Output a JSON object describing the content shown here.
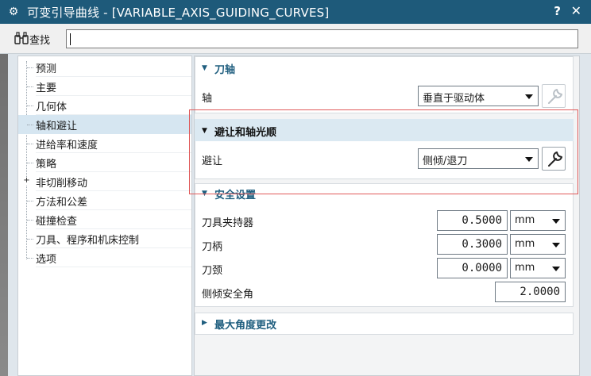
{
  "window": {
    "title": "可变引导曲线 - [VARIABLE_AXIS_GUIDING_CURVES]",
    "help_label": "?",
    "close_label": "✕",
    "title_icon": "gear-icon"
  },
  "findbar": {
    "label": "查找",
    "icon": "binoculars-icon",
    "value": ""
  },
  "tree": {
    "items": [
      {
        "label": "预测",
        "selected": false
      },
      {
        "label": "主要",
        "selected": false
      },
      {
        "label": "几何体",
        "selected": false
      },
      {
        "label": "轴和避让",
        "selected": true
      },
      {
        "label": "进给率和速度",
        "selected": false
      },
      {
        "label": "策略",
        "selected": false
      },
      {
        "label": "非切削移动",
        "selected": false,
        "expandable": true
      },
      {
        "label": "方法和公差",
        "selected": false
      },
      {
        "label": "碰撞检查",
        "selected": false
      },
      {
        "label": "刀具、程序和机床控制",
        "selected": false
      },
      {
        "label": "选项",
        "selected": false
      }
    ],
    "expand_glyph": "+"
  },
  "sections": {
    "tool_axis": {
      "title": "刀轴",
      "axis_label": "轴",
      "axis_value": "垂直于驱动体"
    },
    "avoidance": {
      "title": "避让和轴光顺",
      "avoid_label": "避让",
      "avoid_value": "侧倾/退刀"
    },
    "safety": {
      "title": "安全设置",
      "rows": [
        {
          "label": "刀具夹持器",
          "value": "0.5000",
          "unit": "mm"
        },
        {
          "label": "刀柄",
          "value": "0.3000",
          "unit": "mm"
        },
        {
          "label": "刀颈",
          "value": "0.0000",
          "unit": "mm"
        }
      ],
      "tilt_label": "侧倾安全角",
      "tilt_value": "2.0000"
    },
    "max_angle": {
      "title": "最大角度更改"
    }
  },
  "colors": {
    "titlebar": "#1e5a7a",
    "section_title": "#1f5e7f",
    "selected_row": "#d6e6f1",
    "highlight_box": "#e05a5a"
  }
}
